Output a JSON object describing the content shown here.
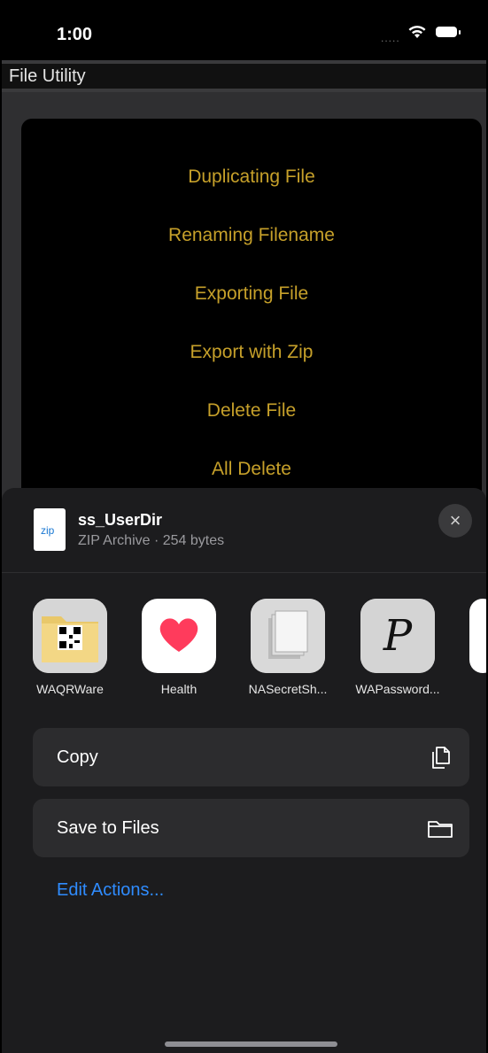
{
  "status_bar": {
    "time": "1:00",
    "signal": "....."
  },
  "app_title": "File Utility",
  "menu": {
    "items": [
      "Duplicating File",
      "Renaming Filename",
      "Exporting File",
      "Export with Zip",
      "Delete File",
      "All Delete"
    ]
  },
  "share_sheet": {
    "file_icon_text": "zip",
    "file_name": "ss_UserDir",
    "file_meta": "ZIP Archive · 254 bytes",
    "close_icon": "×",
    "apps": [
      {
        "name": "WAQRWare",
        "icon": "qr-folder-icon"
      },
      {
        "name": "Health",
        "icon": "heart-icon"
      },
      {
        "name": "NASecretSh...",
        "icon": "documents-icon"
      },
      {
        "name": "WAPassword...",
        "icon": "script-p-icon"
      }
    ],
    "actions": [
      {
        "label": "Copy",
        "icon": "copy-icon"
      },
      {
        "label": "Save to Files",
        "icon": "folder-icon"
      }
    ],
    "edit_actions": "Edit Actions..."
  },
  "colors": {
    "menu_text": "#c6a02a",
    "link": "#2f8cff",
    "sheet_bg": "#1c1c1e"
  }
}
